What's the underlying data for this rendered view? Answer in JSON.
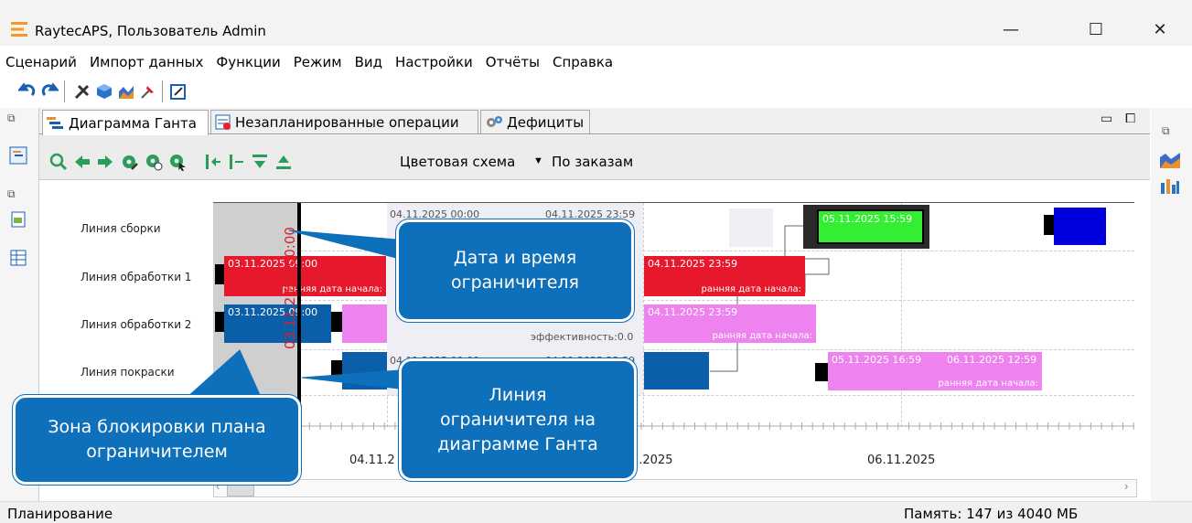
{
  "window": {
    "title": "RaytecAPS, Пользователь Admin",
    "minimize": "—",
    "maximize": "☐",
    "close": "✕"
  },
  "menu": [
    "Сценарий",
    "Импорт данных",
    "Функции",
    "Режим",
    "Вид",
    "Настройки",
    "Отчёты",
    "Справка"
  ],
  "tabs": [
    {
      "label": "Диаграмма Ганта",
      "active": true
    },
    {
      "label": "Незапланированные операции",
      "active": false
    },
    {
      "label": "Дефициты",
      "active": false
    }
  ],
  "gantt_toolbar": {
    "color_scheme_label": "Цветовая схема",
    "order_mode_label": "По заказам",
    "dropdown_arrow": "▼"
  },
  "rows": [
    "Линия сборки",
    "Линия обработки 1",
    "Линия обработки 2",
    "Линия покраски"
  ],
  "timeline": {
    "restrictor_label": "03.11.2025 00:00",
    "axis_labels": [
      "04.11.2",
      "1.2025",
      "06.11.2025"
    ]
  },
  "bars": {
    "assembly_green": "05.11.2025 15:59",
    "proc1_red_left": "03.11.2025 09:00",
    "proc1_red_left_bottom": "ранняя дата начала:",
    "proc1_red_right": "04.11.2025 23:59",
    "proc1_red_right_bottom": "ранняя дата начала:",
    "proc2_blue": "03.11.2025 09:00",
    "proc2_pink": "04.11.2025 23:59",
    "proc2_pink_bottom": "ранняя дата начала:",
    "paint_pink_1": "05.11.2025 16:59",
    "paint_pink_2": "06.11.2025 12:59",
    "paint_pink_bottom": "ранняя дата начала:"
  },
  "grey_texts": {
    "assembly_1": "04.11.2025 00:00",
    "assembly_2": "04.11.2025 23:59",
    "proc2_eff": "эффективность:0.0",
    "paint_1": "04.11.2025 00:00",
    "paint_2": "04.11.2025 23:59"
  },
  "callouts": {
    "datetime": "Дата и время ограничителя",
    "line": "Линия ограничителя на диаграмме Ганта",
    "zone": "Зона блокировки плана ограничителем"
  },
  "status": {
    "left": "Планирование",
    "memory": "Память: 147 из 4040 МБ"
  },
  "colors": {
    "red": "#e8182c",
    "blue": "#0a5fa8",
    "pink": "#ee82ee",
    "green": "#33ee33",
    "darkblue": "#0000dd",
    "callout": "#0e6fba"
  }
}
